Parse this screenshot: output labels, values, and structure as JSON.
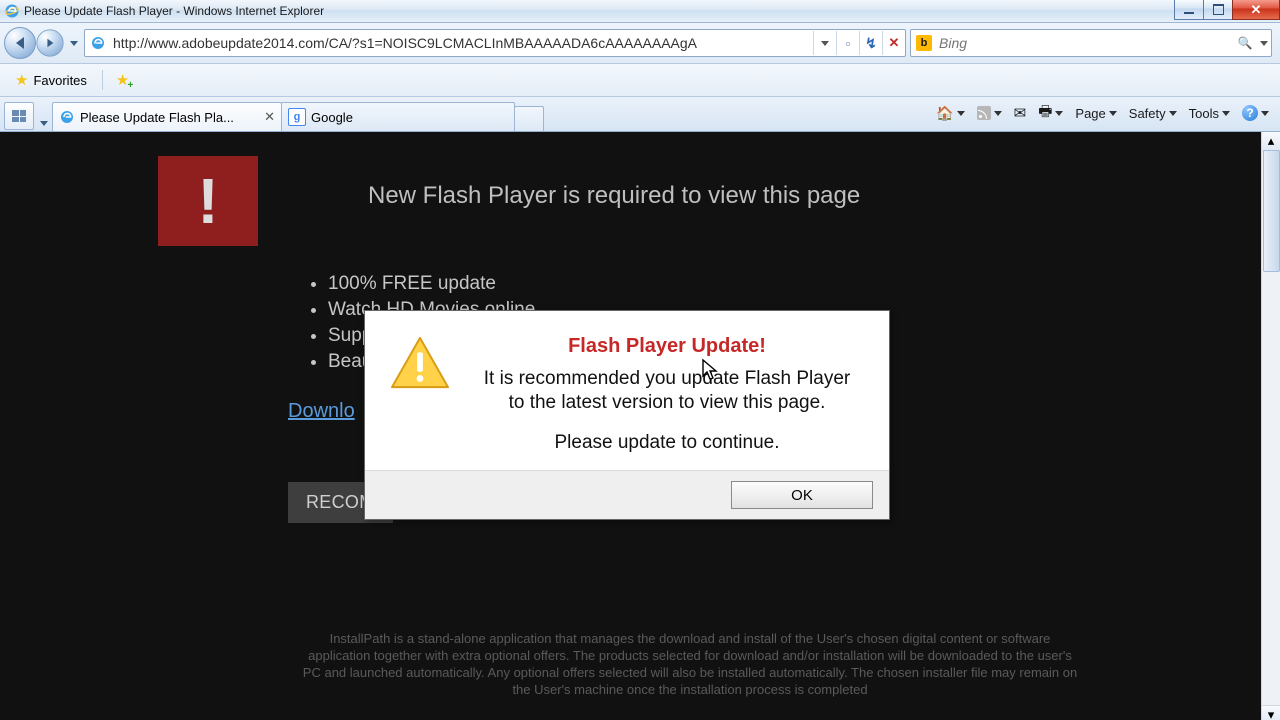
{
  "window": {
    "title": "Please Update Flash Player - Windows Internet Explorer"
  },
  "nav": {
    "url": "http://www.adobeupdate2014.com/CA/?s1=NOISC9LCMACLInMBAAAAADA6cAAAAAAAAgA"
  },
  "search": {
    "engine_letter": "b",
    "placeholder": "Bing"
  },
  "favbar": {
    "favorites_label": "Favorites"
  },
  "tabs": {
    "active_label": "Please Update Flash Pla...",
    "google_label": "Google"
  },
  "cmdbar": {
    "page": "Page",
    "safety": "Safety",
    "tools": "Tools"
  },
  "content": {
    "headline": "New Flash Player is required to view this page",
    "bullets": {
      "0": "100% FREE update",
      "1": "Watch HD Movies online",
      "2": "Suppo",
      "3": "Beauti"
    },
    "download_link": "Downlo",
    "recommend_btn": "RECOM",
    "footer": "InstallPath is a stand-alone application that manages the download and install of the User's chosen digital content or software application together with extra optional offers. The products selected for download and/or installation will be downloaded to the user's PC and launched automatically. Any optional offers selected will also be installed automatically. The chosen installer file may remain on the User's machine once the installation process is completed"
  },
  "modal": {
    "title": "Flash Player Update!",
    "line1": "It is recommended you update Flash Player",
    "line2": "to the latest version to view this page.",
    "line3": "Please update to continue.",
    "ok": "OK"
  }
}
